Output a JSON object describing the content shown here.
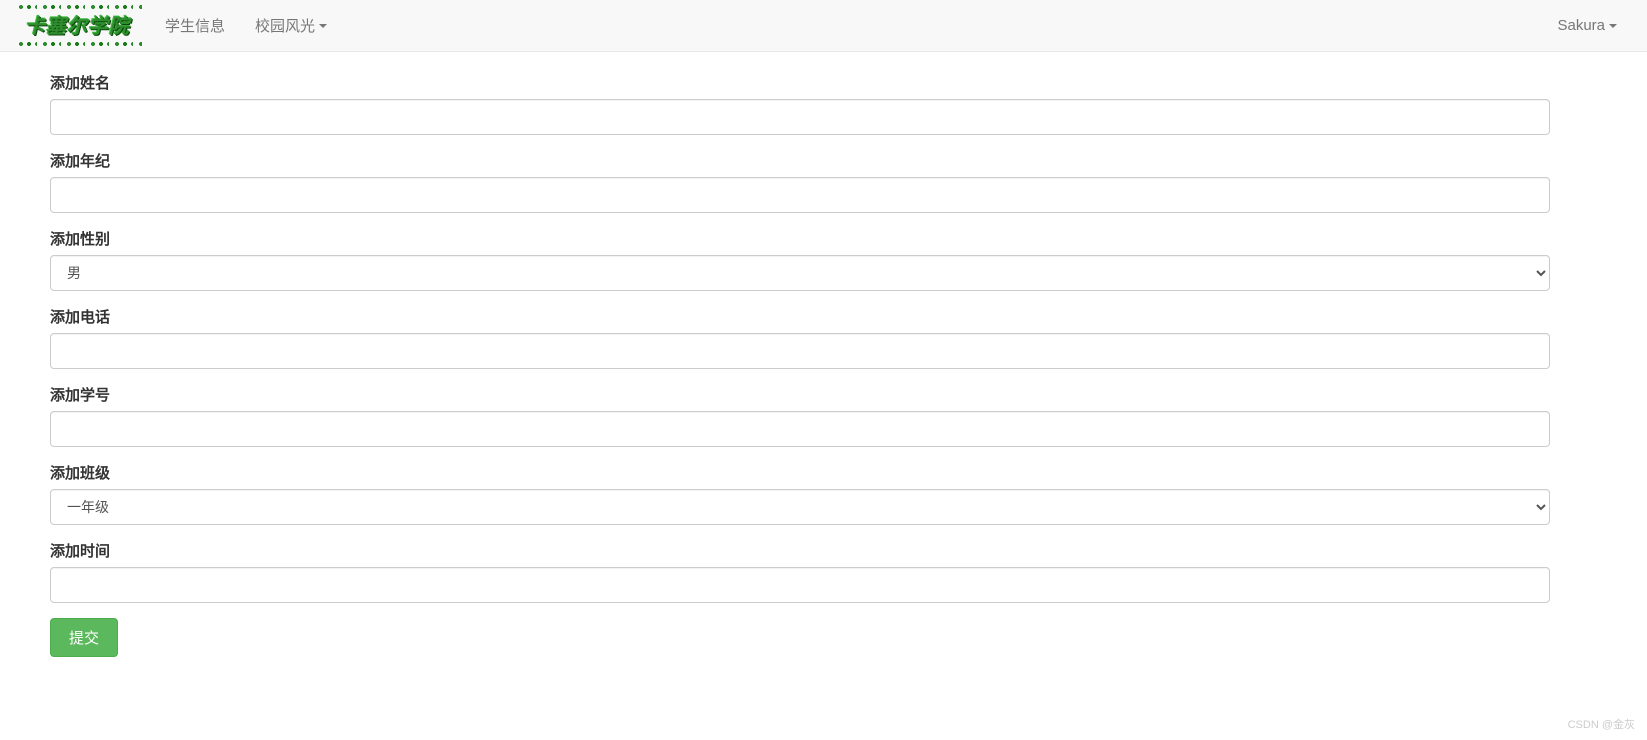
{
  "navbar": {
    "brand": "卡塞尔学院",
    "left_items": [
      {
        "label": "学生信息",
        "dropdown": false
      },
      {
        "label": "校园风光",
        "dropdown": true
      }
    ],
    "right_items": [
      {
        "label": "Sakura",
        "dropdown": true
      }
    ]
  },
  "form": {
    "name": {
      "label": "添加姓名",
      "value": ""
    },
    "age": {
      "label": "添加年纪",
      "value": ""
    },
    "gender": {
      "label": "添加性别",
      "selected": "男"
    },
    "phone": {
      "label": "添加电话",
      "value": ""
    },
    "studentId": {
      "label": "添加学号",
      "value": ""
    },
    "class": {
      "label": "添加班级",
      "selected": "一年级"
    },
    "time": {
      "label": "添加时间",
      "value": ""
    },
    "submit_label": "提交"
  },
  "watermark": "CSDN @金灰"
}
